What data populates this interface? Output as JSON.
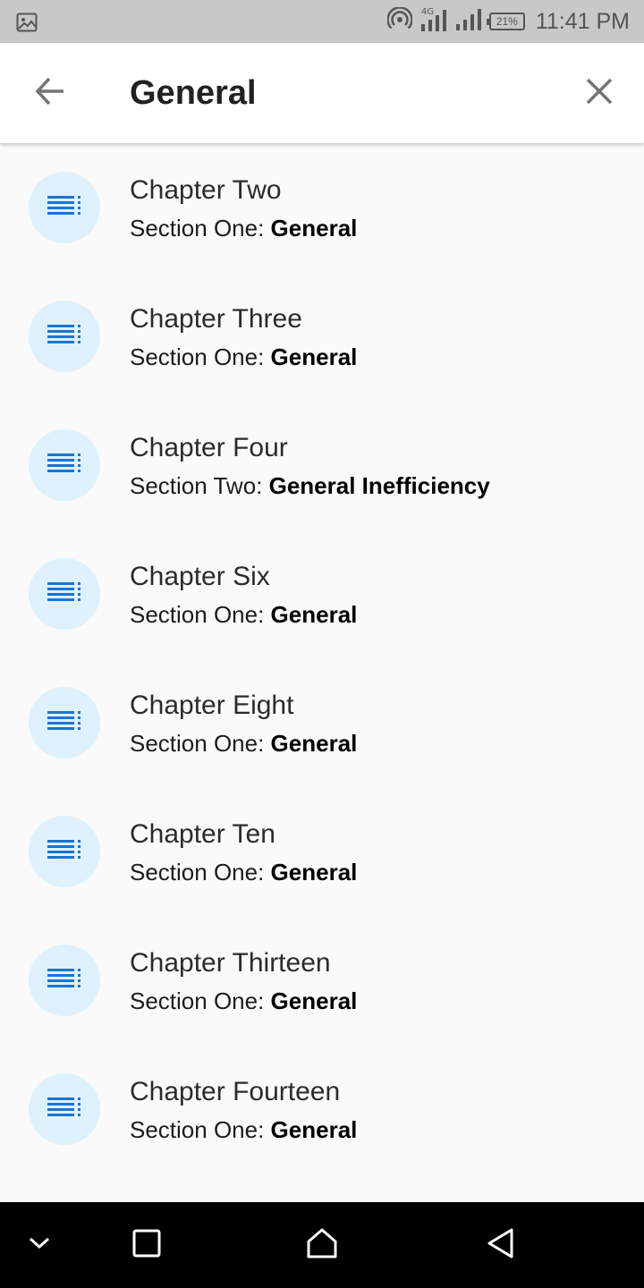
{
  "status_bar": {
    "time": "11:41 PM",
    "battery": "21%",
    "network": "4G"
  },
  "app_bar": {
    "title": "General"
  },
  "results": [
    {
      "title": "Chapter Two",
      "section": "Section One: ",
      "match": "General"
    },
    {
      "title": "Chapter Three",
      "section": "Section One: ",
      "match": "General"
    },
    {
      "title": "Chapter Four",
      "section": "Section Two: ",
      "match": "General Inefficiency"
    },
    {
      "title": "Chapter Six",
      "section": "Section One: ",
      "match": "General"
    },
    {
      "title": "Chapter Eight",
      "section": "Section One: ",
      "match": "General"
    },
    {
      "title": "Chapter Ten",
      "section": "Section One: ",
      "match": "General"
    },
    {
      "title": "Chapter Thirteen",
      "section": "Section One: ",
      "match": "General"
    },
    {
      "title": "Chapter Fourteen",
      "section": "Section One: ",
      "match": "General"
    }
  ],
  "icons": {
    "back": "arrow-left-icon",
    "close": "close-icon",
    "list": "list-icon",
    "nav_down": "chevron-down-icon",
    "nav_recents": "square-icon",
    "nav_home": "home-icon",
    "nav_back": "triangle-back-icon"
  },
  "colors": {
    "accent": "#1976d2",
    "avatar_bg": "#dff1fc",
    "status_bar": "#c8c8c8",
    "background": "#fafafa"
  }
}
